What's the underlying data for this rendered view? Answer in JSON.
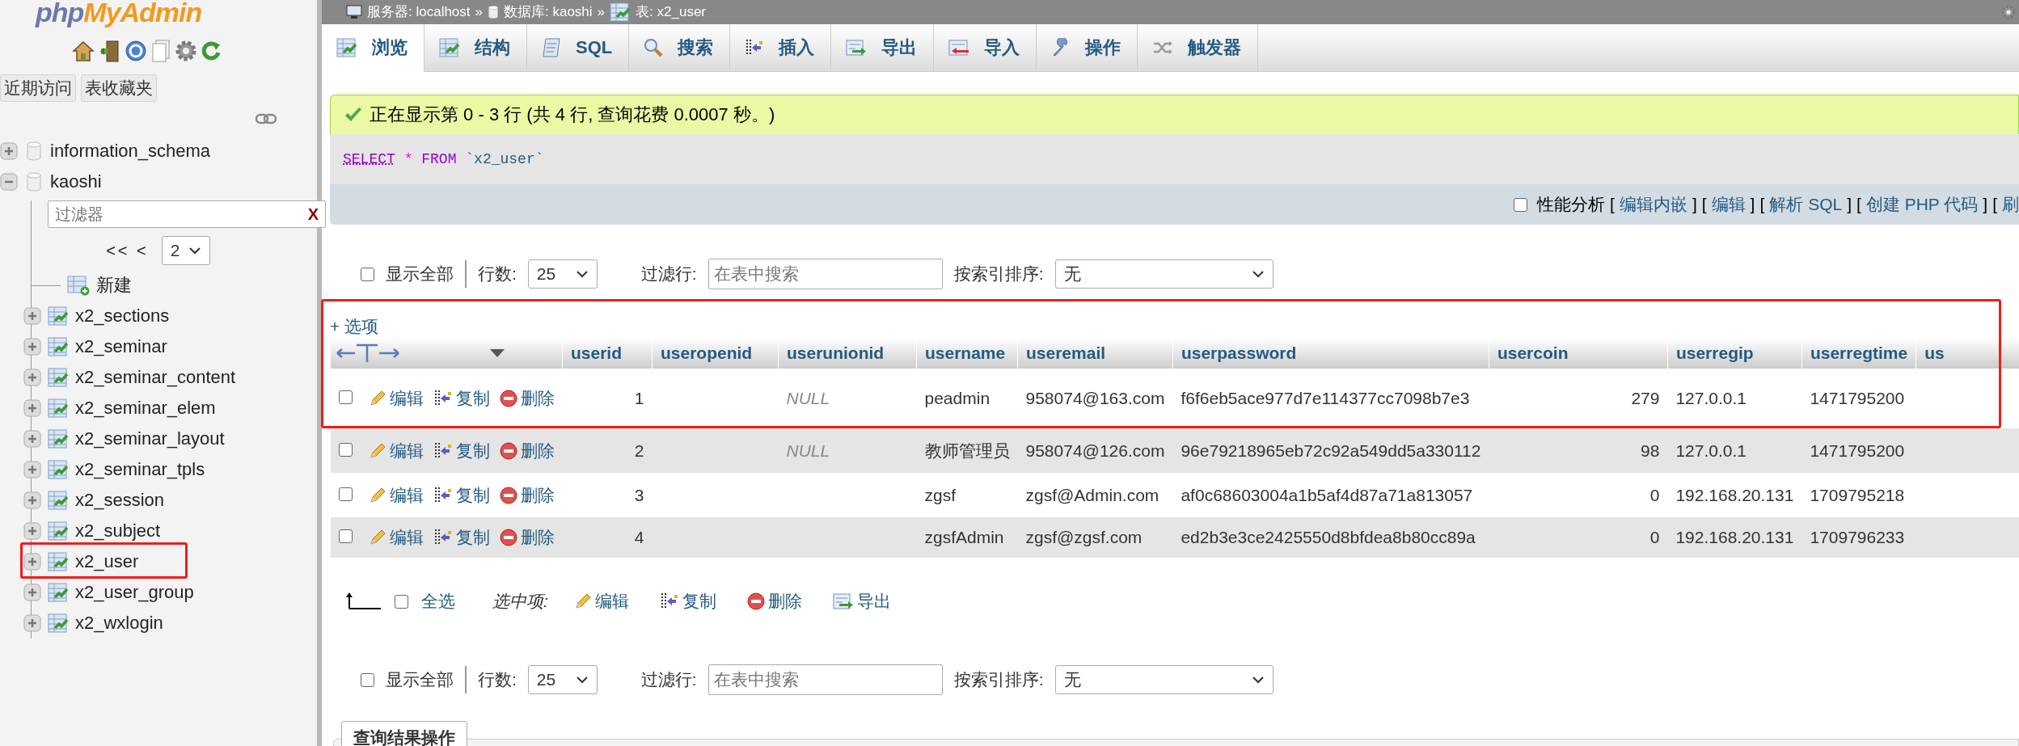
{
  "sidebar": {
    "logo": [
      "php",
      "MyAdmin"
    ],
    "nav_tabs": [
      "近期访问",
      "表收藏夹"
    ],
    "tree": [
      {
        "kind": "database",
        "name": "information_schema",
        "expanded": false
      },
      {
        "kind": "database",
        "name": "kaoshi",
        "expanded": true,
        "filter": {
          "placeholder": "过滤器",
          "clear": "X"
        },
        "pager": {
          "prev": "<< <",
          "page": "2"
        },
        "children": [
          {
            "kind": "new",
            "name": "新建"
          },
          {
            "kind": "table",
            "name": "x2_sections",
            "expanded": false
          },
          {
            "kind": "table",
            "name": "x2_seminar",
            "expanded": false
          },
          {
            "kind": "table",
            "name": "x2_seminar_content",
            "expanded": false
          },
          {
            "kind": "table",
            "name": "x2_seminar_elem",
            "expanded": false
          },
          {
            "kind": "table",
            "name": "x2_seminar_layout",
            "expanded": false
          },
          {
            "kind": "table",
            "name": "x2_seminar_tpls",
            "expanded": false
          },
          {
            "kind": "table",
            "name": "x2_session",
            "expanded": false
          },
          {
            "kind": "table",
            "name": "x2_subject",
            "expanded": false
          },
          {
            "kind": "table",
            "name": "x2_user",
            "expanded": false
          },
          {
            "kind": "table",
            "name": "x2_user_group",
            "expanded": false
          },
          {
            "kind": "table",
            "name": "x2_wxlogin",
            "expanded": false
          }
        ]
      }
    ]
  },
  "breadcrumb": [
    {
      "kind": "server",
      "label": "服务器: localhost"
    },
    {
      "kind": "separator",
      "label": "»"
    },
    {
      "kind": "database",
      "label": "数据库: kaoshi"
    },
    {
      "kind": "separator",
      "label": "»"
    },
    {
      "kind": "table",
      "label": "表: x2_user"
    }
  ],
  "tabs": [
    {
      "kind": "browse",
      "label": "浏览",
      "selected": true
    },
    {
      "kind": "structure",
      "label": "结构",
      "selected": false
    },
    {
      "kind": "sql",
      "label": "SQL",
      "selected": false
    },
    {
      "kind": "search",
      "label": "搜索",
      "selected": false
    },
    {
      "kind": "insert",
      "label": "插入",
      "selected": false
    },
    {
      "kind": "export",
      "label": "导出",
      "selected": false
    },
    {
      "kind": "import",
      "label": "导入",
      "selected": false
    },
    {
      "kind": "operations",
      "label": "操作",
      "selected": false
    },
    {
      "kind": "triggers",
      "label": "触发器",
      "selected": false
    }
  ],
  "message": "正在显示第 0 - 3 行 (共 4 行, 查询花费 0.0007 秒。)",
  "sql": [
    {
      "kind": "keyword",
      "text": "SELECT"
    },
    {
      "kind": "operator",
      "text": "*"
    },
    {
      "kind": "keyword",
      "text": "FROM"
    },
    {
      "kind": "identifier",
      "text": "`x2_user`"
    }
  ],
  "profiling": {
    "label": "性能分析",
    "checked": false,
    "links": [
      {
        "open": "[",
        "text": "编辑内嵌",
        "close": "]"
      },
      {
        "open": "[",
        "text": "编辑",
        "close": "]"
      },
      {
        "open": "[",
        "text": "解析 SQL",
        "close": "]"
      },
      {
        "open": "[",
        "text": "创建 PHP 代码",
        "close": "]"
      },
      {
        "open": "[",
        "text": "刷"
      }
    ]
  },
  "nav_top": {
    "show_all": {
      "label": "显示全部",
      "checked": false
    },
    "rows_label": "行数:",
    "rows_value": "25",
    "filter_label": "过滤行:",
    "filter_placeholder": "在表中搜索",
    "sort_label": "按索引排序:",
    "sort_value": "无"
  },
  "options_link": "+ 选项",
  "table": {
    "columns": [
      "userid",
      "useropenid",
      "userunionid",
      "username",
      "useremail",
      "userpassword",
      "usercoin",
      "userregip",
      "userregtime",
      "us"
    ],
    "rows": [
      {
        "checked": false,
        "actions": [
          {
            "kind": "edit",
            "label": "编辑"
          },
          {
            "kind": "copy",
            "label": "复制"
          },
          {
            "kind": "delete",
            "label": "删除"
          }
        ],
        "cells": [
          "1",
          null,
          {
            "kind": "null",
            "text": "NULL"
          },
          "peadmin",
          "958074@163.com",
          "f6f6eb5ace977d7e114377cc7098b7e3",
          "279",
          "127.0.0.1",
          "1471795200"
        ]
      },
      {
        "checked": false,
        "actions": [
          {
            "kind": "edit",
            "label": "编辑"
          },
          {
            "kind": "copy",
            "label": "复制"
          },
          {
            "kind": "delete",
            "label": "删除"
          }
        ],
        "cells": [
          "2",
          null,
          {
            "kind": "null",
            "text": "NULL"
          },
          "教师管理员",
          "958074@126.com",
          "96e79218965eb72c92a549dd5a330112",
          "98",
          "127.0.0.1",
          "1471795200"
        ]
      },
      {
        "checked": false,
        "actions": [
          {
            "kind": "edit",
            "label": "编辑"
          },
          {
            "kind": "copy",
            "label": "复制"
          },
          {
            "kind": "delete",
            "label": "删除"
          }
        ],
        "cells": [
          "3",
          null,
          null,
          "zgsf",
          "zgsf@Admin.com",
          "af0c68603004a1b5af4d87a71a813057",
          "0",
          "192.168.20.131",
          "1709795218"
        ]
      },
      {
        "checked": false,
        "actions": [
          {
            "kind": "edit",
            "label": "编辑"
          },
          {
            "kind": "copy",
            "label": "复制"
          },
          {
            "kind": "delete",
            "label": "删除"
          }
        ],
        "cells": [
          "4",
          null,
          null,
          "zgsfAdmin",
          "zgsf@zgsf.com",
          "ed2b3e3ce2425550d8bfdea8b80cc89a",
          "0",
          "192.168.20.131",
          "1709796233"
        ]
      }
    ]
  },
  "bulk": {
    "check_all": {
      "label": "全选",
      "checked": false
    },
    "with_selected": "选中项:",
    "actions": [
      {
        "kind": "edit",
        "label": "编辑"
      },
      {
        "kind": "copy",
        "label": "复制"
      },
      {
        "kind": "delete",
        "label": "删除"
      },
      {
        "kind": "export",
        "label": "导出"
      }
    ]
  },
  "nav_bottom": {
    "show_all": {
      "label": "显示全部",
      "checked": false
    },
    "rows_label": "行数:",
    "rows_value": "25",
    "filter_label": "过滤行:",
    "filter_placeholder": "在表中搜索",
    "sort_label": "按索引排序:",
    "sort_value": "无"
  },
  "query_ops": "查询结果操作"
}
